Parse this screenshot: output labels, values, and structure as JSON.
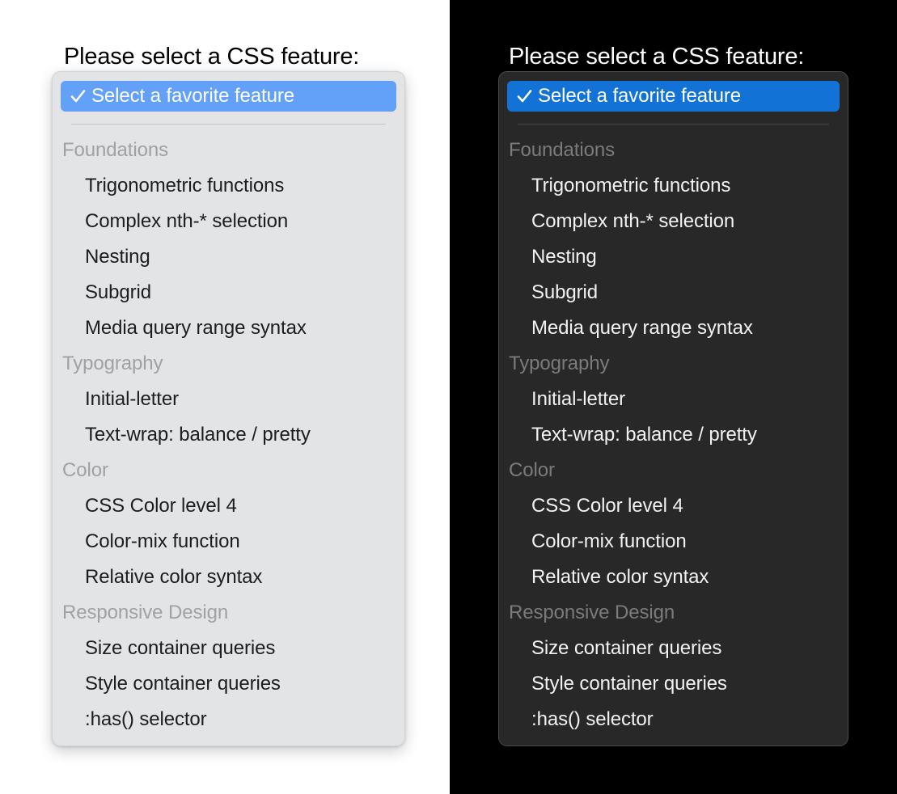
{
  "prompt": "Please select a CSS feature:",
  "select": {
    "selected_label": "Select a favorite feature",
    "check_icon": "checkmark-icon"
  },
  "colors": {
    "light_panel_bg": "#e3e4e6",
    "light_highlight": "#63a0f7",
    "dark_page_bg": "#000000",
    "dark_panel_bg": "#282828",
    "dark_highlight": "#1272d6",
    "light_group_label": "#a0a1a3",
    "dark_group_label": "#7b7b7b"
  },
  "groups": [
    {
      "label": "Foundations",
      "options": [
        "Trigonometric functions",
        "Complex nth-* selection",
        "Nesting",
        "Subgrid",
        "Media query range syntax"
      ]
    },
    {
      "label": "Typography",
      "options": [
        "Initial-letter",
        "Text-wrap: balance / pretty"
      ]
    },
    {
      "label": "Color",
      "options": [
        "CSS Color level 4",
        "Color-mix function",
        "Relative color syntax"
      ]
    },
    {
      "label": "Responsive Design",
      "options": [
        "Size container queries",
        "Style container queries",
        ":has() selector"
      ]
    }
  ]
}
